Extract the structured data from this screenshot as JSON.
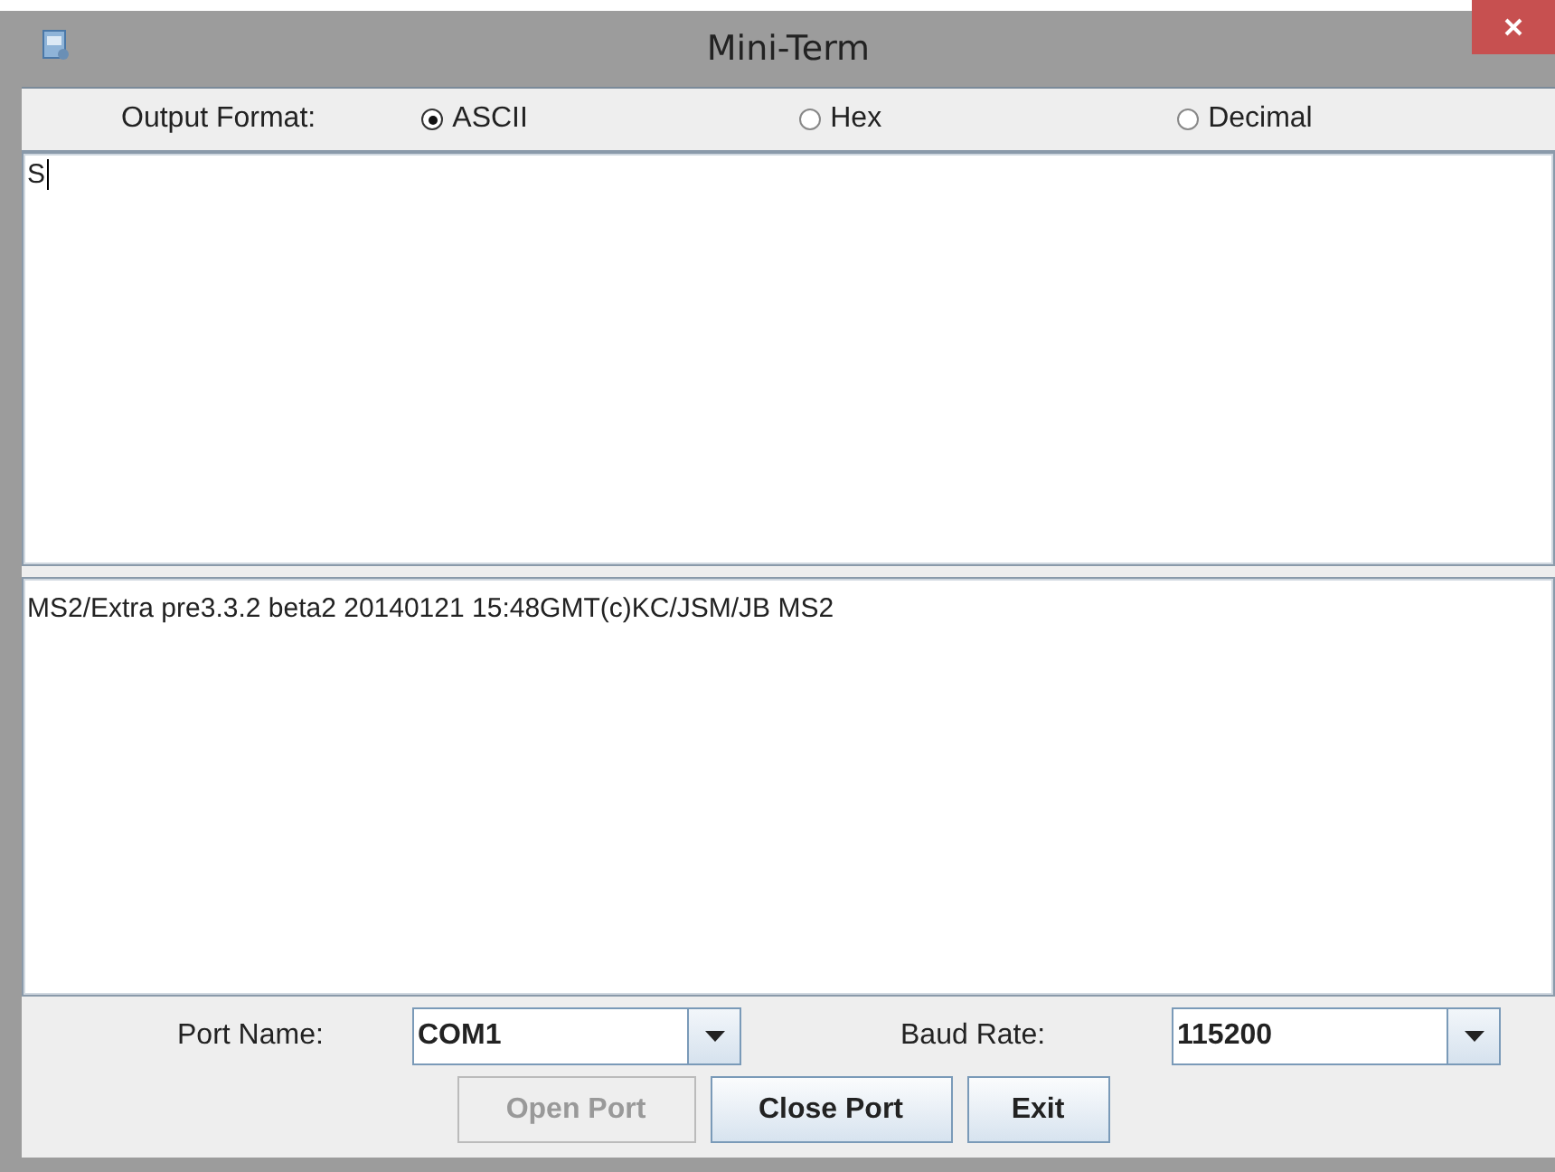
{
  "window": {
    "title": "Mini-Term"
  },
  "output_format": {
    "label": "Output Format:",
    "options": [
      {
        "label": "ASCII",
        "selected": true
      },
      {
        "label": "Hex",
        "selected": false
      },
      {
        "label": "Decimal",
        "selected": false
      }
    ]
  },
  "input_area": {
    "value": "S"
  },
  "output_area": {
    "text": "MS2/Extra pre3.3.2 beta2 20140121 15:48GMT(c)KC/JSM/JB   MS2"
  },
  "port_name": {
    "label": "Port Name:",
    "value": "COM1"
  },
  "baud_rate": {
    "label": "Baud Rate:",
    "value": "115200"
  },
  "buttons": [
    {
      "label": "Open Port",
      "disabled": true
    },
    {
      "label": "Close Port",
      "disabled": false
    },
    {
      "label": "Exit",
      "disabled": false
    }
  ]
}
